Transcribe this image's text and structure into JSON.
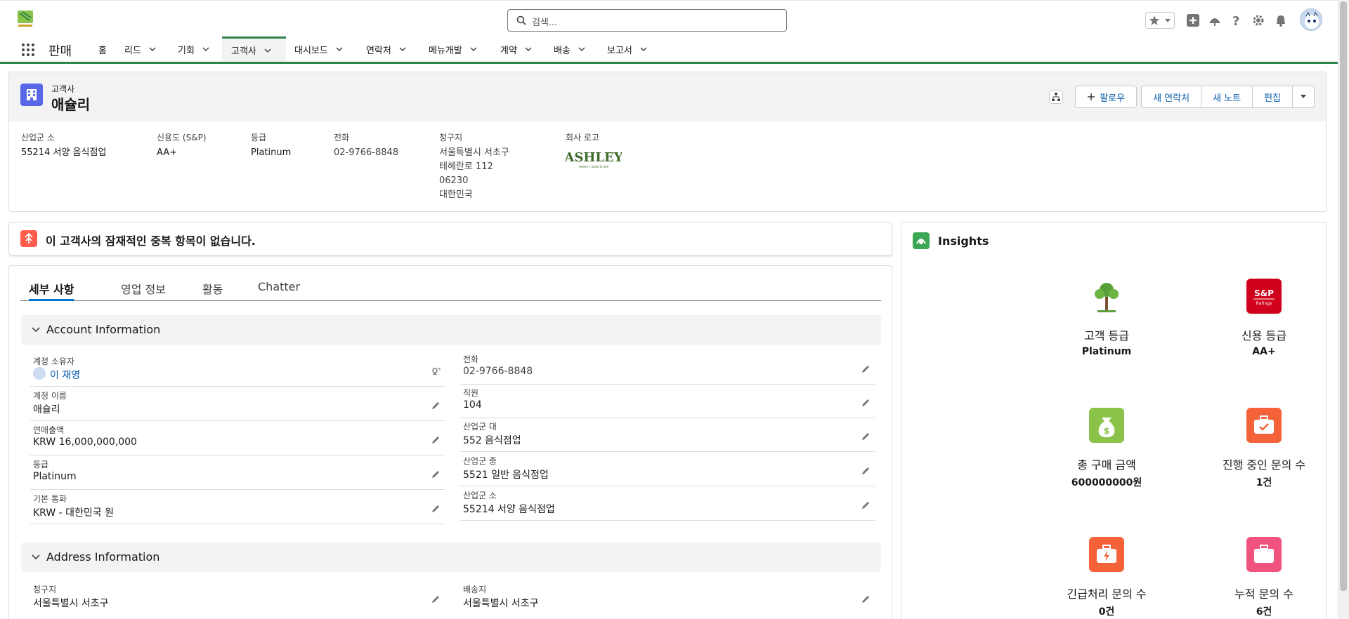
{
  "header": {
    "search_placeholder": "검색...",
    "app_name": "판매"
  },
  "nav": {
    "items": [
      {
        "label": "홈"
      },
      {
        "label": "리드"
      },
      {
        "label": "기회"
      },
      {
        "label": "고객사"
      },
      {
        "label": "대시보드"
      },
      {
        "label": "연락처"
      },
      {
        "label": "메뉴개발"
      },
      {
        "label": "계약"
      },
      {
        "label": "배송"
      },
      {
        "label": "보고서"
      }
    ],
    "active": "고객사"
  },
  "record": {
    "object_type": "고객사",
    "name": "애슐리",
    "actions": {
      "follow": "팔로우",
      "new_contact": "새 연락처",
      "new_note": "새 노트",
      "edit": "편집"
    },
    "highlights": [
      {
        "label": "산업군 소",
        "lines": [
          "55214 서양 음식점업"
        ]
      },
      {
        "label": "신용도 (S&P)",
        "lines": [
          "AA+"
        ]
      },
      {
        "label": "등급",
        "lines": [
          "Platinum"
        ]
      },
      {
        "label": "전화",
        "lines": [
          "02-9766-8848"
        ]
      },
      {
        "label": "청구지",
        "lines": [
          "서울특별시 서초구",
          "테헤란로 112",
          "06230",
          "대한민국"
        ]
      },
      {
        "label": "회사 로고",
        "lines": []
      }
    ],
    "logo_text": "ASHLEY",
    "logo_sub": "Ashley's Salad & Grill"
  },
  "duplicates": {
    "message": "이 고객사의 잠재적인 중복 항목이 없습니다."
  },
  "tabs": [
    "세부 사항",
    "영업 정보",
    "활동",
    "Chatter"
  ],
  "sections": {
    "account": "Account Information",
    "address": "Address Information"
  },
  "fields_left": [
    {
      "label": "계정 소유자",
      "value": "이 재영"
    },
    {
      "label": "계정 이름",
      "value": "애슐리"
    },
    {
      "label": "연매출액",
      "value": "KRW 16,000,000,000"
    },
    {
      "label": "등급",
      "value": "Platinum"
    },
    {
      "label": "기본 통화",
      "value": "KRW - 대한민국 원"
    }
  ],
  "fields_right": [
    {
      "label": "전화",
      "value": "02-9766-8848"
    },
    {
      "label": "직원",
      "value": "104"
    },
    {
      "label": "산업군 대",
      "value": "552 음식점업"
    },
    {
      "label": "산업군 중",
      "value": "5521 일반 음식점업"
    },
    {
      "label": "산업군 소",
      "value": "55214 서양 음식점업"
    }
  ],
  "address_fields": [
    {
      "label": "청구지",
      "value": "서울특별시 서초구"
    },
    {
      "label": "배송지",
      "value": "서울특별시 서초구"
    }
  ],
  "insights": {
    "title": "Insights",
    "metrics": [
      {
        "label": "고객 등급",
        "value": "Platinum",
        "icon": "tree-icon",
        "color": "#ffffff"
      },
      {
        "label": "신용 등급",
        "value": "AA+",
        "icon": "sp-ratings-icon",
        "color": "#d0021b"
      },
      {
        "label": "총 구매 금액",
        "value": "600000000원",
        "icon": "money-bag-icon",
        "color": "#8bc34a"
      },
      {
        "label": "진행 중인 문의 수",
        "value": "1건",
        "icon": "case-check-icon",
        "color": "#f4623a"
      },
      {
        "label": "긴급처리 문의 수",
        "value": "0건",
        "icon": "case-urgent-icon",
        "color": "#f4623a"
      },
      {
        "label": "누적 문의 수",
        "value": "6건",
        "icon": "case-total-icon",
        "color": "#f0537e"
      }
    ],
    "sp_text": "S&P",
    "sp_sub": "Ratings"
  },
  "colors": {
    "brand_green": "#2e844a",
    "link_blue": "#0b5cab",
    "account_icon": "#5867e8"
  }
}
